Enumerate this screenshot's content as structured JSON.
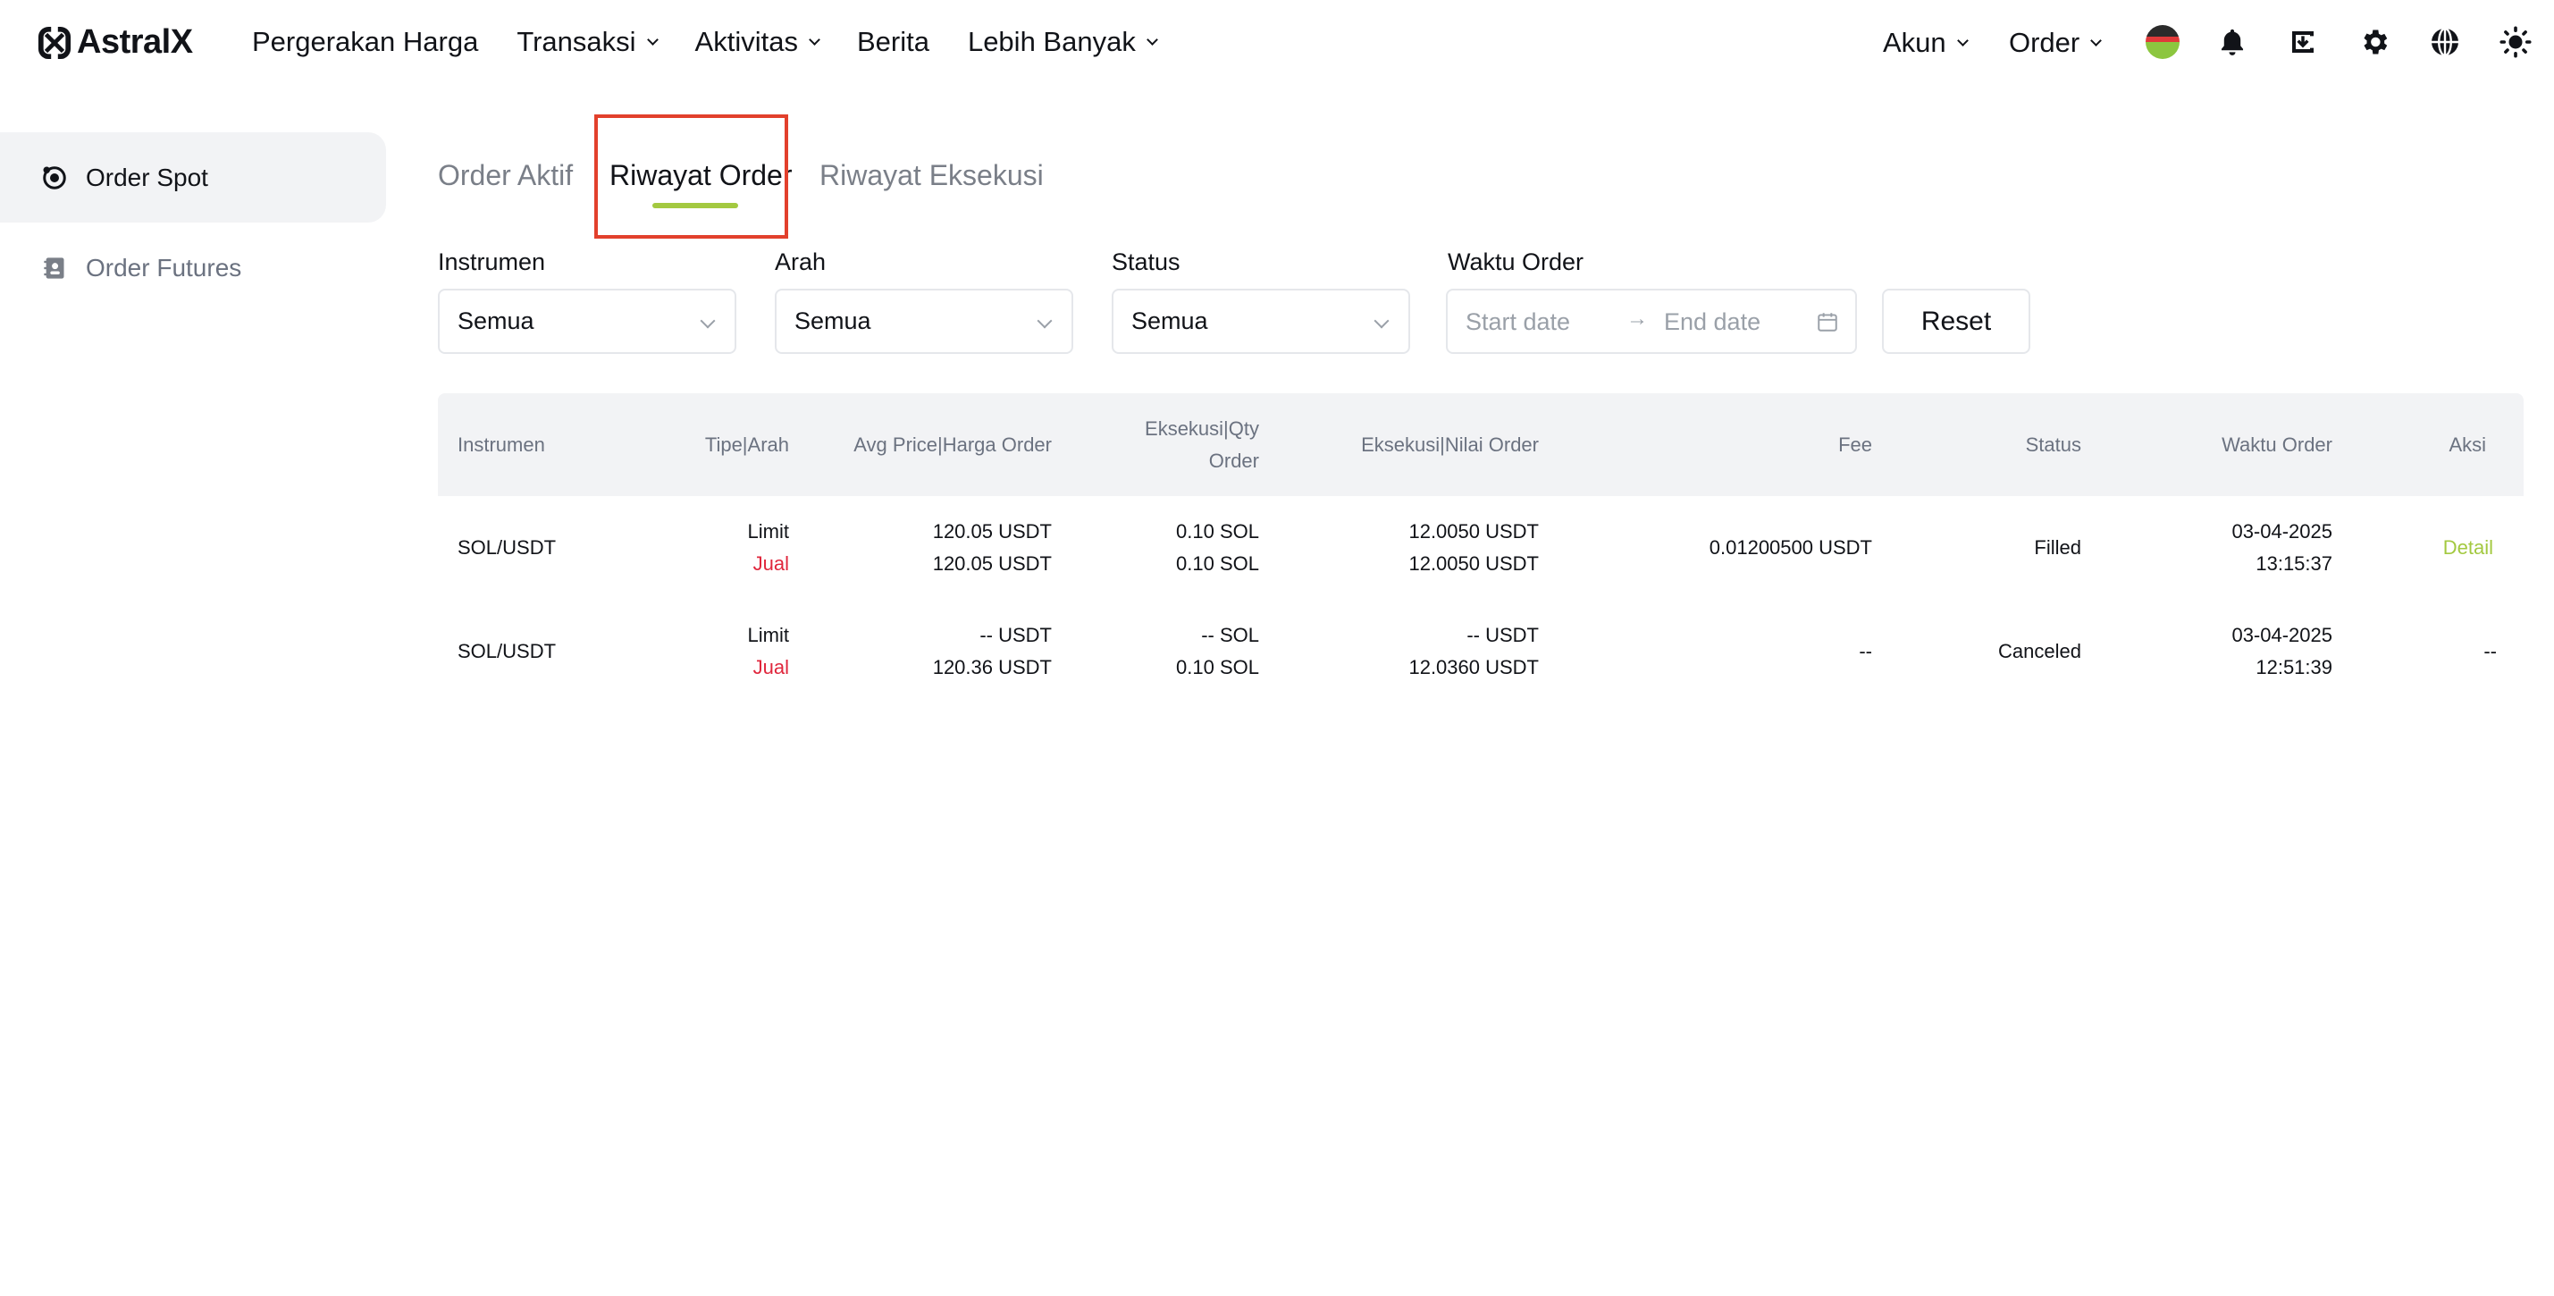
{
  "header": {
    "logo_text": "AstralX",
    "nav": [
      {
        "label": "Pergerakan Harga",
        "dropdown": false
      },
      {
        "label": "Transaksi",
        "dropdown": true
      },
      {
        "label": "Aktivitas",
        "dropdown": true
      },
      {
        "label": "Berita",
        "dropdown": false
      },
      {
        "label": "Lebih Banyak",
        "dropdown": true
      }
    ],
    "right": {
      "akun_label": "Akun",
      "order_label": "Order",
      "icons": [
        "flag-icon",
        "bell-icon",
        "download-icon",
        "gear-icon",
        "globe-icon",
        "sun-icon"
      ]
    }
  },
  "sidebar": {
    "items": [
      {
        "label": "Order Spot",
        "active": true,
        "icon": "spot-order-icon"
      },
      {
        "label": "Order Futures",
        "active": false,
        "icon": "futures-order-icon"
      }
    ]
  },
  "tabs": [
    {
      "label": "Order Aktif",
      "active": false
    },
    {
      "label": "Riwayat Order",
      "active": true
    },
    {
      "label": "Riwayat Eksekusi",
      "active": false
    }
  ],
  "filters": {
    "instrument": {
      "label": "Instrumen",
      "value": "Semua"
    },
    "direction": {
      "label": "Arah",
      "value": "Semua"
    },
    "status": {
      "label": "Status",
      "value": "Semua"
    },
    "order_time": {
      "label": "Waktu Order",
      "start_placeholder": "Start date",
      "end_placeholder": "End date"
    },
    "reset_label": "Reset"
  },
  "table": {
    "headers": {
      "instrument": "Instrumen",
      "type_dir": "Tipe|Arah",
      "price": "Avg Price|Harga Order",
      "qty_1": "Eksekusi|Qty",
      "qty_2": "Order",
      "value": "Eksekusi|Nilai Order",
      "fee": "Fee",
      "status": "Status",
      "time": "Waktu Order",
      "action": "Aksi"
    },
    "rows": [
      {
        "instrument": "SOL/USDT",
        "type": "Limit",
        "direction": "Jual",
        "avg_price": "120.05 USDT",
        "order_price": "120.05 USDT",
        "exec_qty": "0.10 SOL",
        "order_qty": "0.10 SOL",
        "exec_value": "12.0050 USDT",
        "order_value": "12.0050 USDT",
        "fee": "0.01200500 USDT",
        "status": "Filled",
        "date": "03-04-2025",
        "time": "13:15:37",
        "action": "Detail"
      },
      {
        "instrument": "SOL/USDT",
        "type": "Limit",
        "direction": "Jual",
        "avg_price": "-- USDT",
        "order_price": "120.36 USDT",
        "exec_qty": "-- SOL",
        "order_qty": "0.10 SOL",
        "exec_value": "-- USDT",
        "order_value": "12.0360 USDT",
        "fee": "--",
        "status": "Canceled",
        "date": "03-04-2025",
        "time": "12:51:39",
        "action": "--"
      }
    ]
  },
  "colors": {
    "accent": "#a3c940",
    "sell": "#e0263c",
    "highlight": "#e2402c",
    "header_bg": "#f2f3f5"
  }
}
